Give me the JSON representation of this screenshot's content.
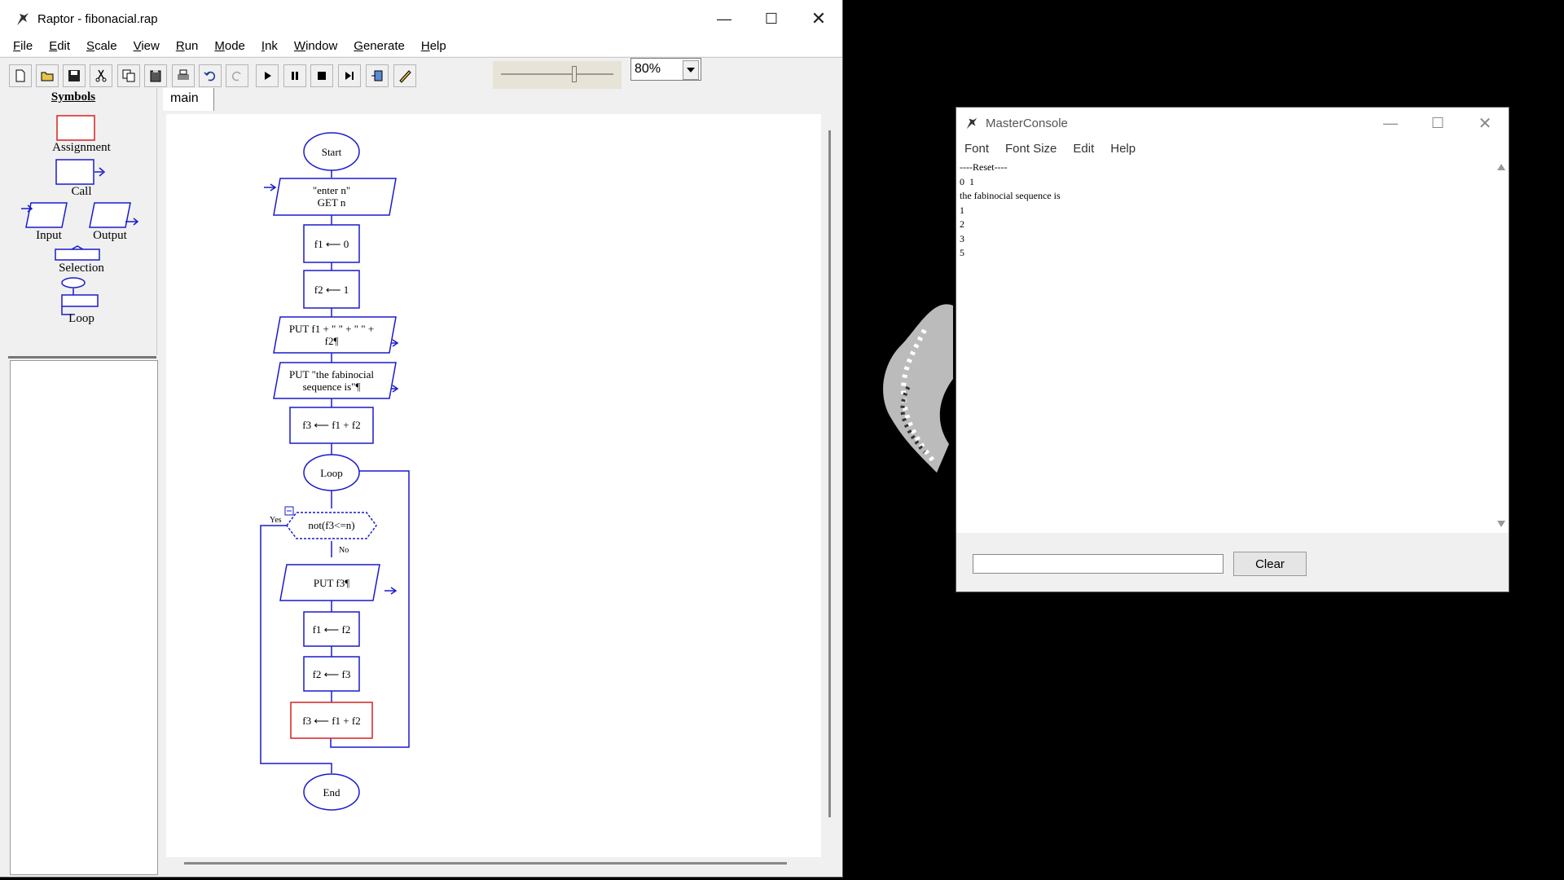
{
  "raptor": {
    "title": "Raptor - fibonacial.rap",
    "menu": [
      {
        "u": "F",
        "rest": "ile"
      },
      {
        "u": "E",
        "rest": "dit"
      },
      {
        "u": "S",
        "rest": "cale"
      },
      {
        "u": "V",
        "rest": "iew"
      },
      {
        "u": "R",
        "rest": "un"
      },
      {
        "u": "M",
        "rest": "ode"
      },
      {
        "u": "I",
        "rest": "nk"
      },
      {
        "u": "W",
        "rest": "indow"
      },
      {
        "u": "G",
        "rest": "enerate"
      },
      {
        "u": "H",
        "rest": "elp"
      }
    ],
    "zoom": "80%",
    "speed_level": 0.65,
    "symbols_header": "Symbols",
    "symbols": {
      "assignment": "Assignment",
      "call": "Call",
      "input": "Input",
      "output": "Output",
      "selection": "Selection",
      "loop": "Loop"
    },
    "tab": "main",
    "flowchart": {
      "start": "Start",
      "input_prompt": "\"enter n\"",
      "input_var": "GET n",
      "assign1": "f1 ⟵ 0",
      "assign2": "f2 ⟵ 1",
      "output1_line1": "PUT f1 + \" \" + \" \" +",
      "output1_line2": "f2¶",
      "output2_line1": "PUT \"the fabinocial",
      "output2_line2": "sequence is\"¶",
      "assign3": "f3 ⟵ f1 + f2",
      "loop": "Loop",
      "condition": "not(f3<=n)",
      "yes": "Yes",
      "no": "No",
      "output3": "PUT f3¶",
      "assign4": "f1 ⟵ f2",
      "assign5": "f2 ⟵ f3",
      "assign6": "f3 ⟵ f1 + f2",
      "end": "End"
    }
  },
  "console": {
    "title": "MasterConsole",
    "menu": [
      "Font",
      "Font Size",
      "Edit",
      "Help"
    ],
    "lines": [
      "----Reset----",
      "0  1",
      "the fabinocial sequence is",
      "1",
      "2",
      "3",
      "5"
    ],
    "input_value": "",
    "clear_label": "Clear"
  },
  "colors": {
    "flow_blue": "#1a1acc",
    "active_red": "#d62020"
  }
}
